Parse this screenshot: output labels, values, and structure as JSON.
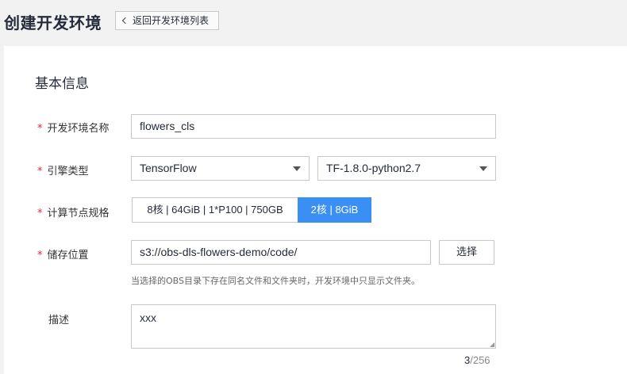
{
  "header": {
    "title": "创建开发环境",
    "back_label": "返回开发环境列表"
  },
  "form": {
    "section_title": "基本信息",
    "name": {
      "label": "开发环境名称",
      "value": "flowers_cls"
    },
    "engine": {
      "label": "引擎类型",
      "type_value": "TensorFlow",
      "version_value": "TF-1.8.0-python2.7"
    },
    "spec": {
      "label": "计算节点规格",
      "options": [
        "8核 | 64GiB | 1*P100 | 750GB",
        "2核 | 8GiB"
      ],
      "selected_index": 1
    },
    "storage": {
      "label": "储存位置",
      "value": "s3://obs-dls-flowers-demo/code/",
      "choose_label": "选择",
      "hint": "当选择的OBS目录下存在同名文件和文件夹时，开发环境中只显示文件夹。"
    },
    "description": {
      "label": "描述",
      "value": "xxx",
      "count": "3",
      "max": "/256"
    }
  },
  "colors": {
    "primary": "#3a8ff5",
    "required": "#f5222d"
  }
}
